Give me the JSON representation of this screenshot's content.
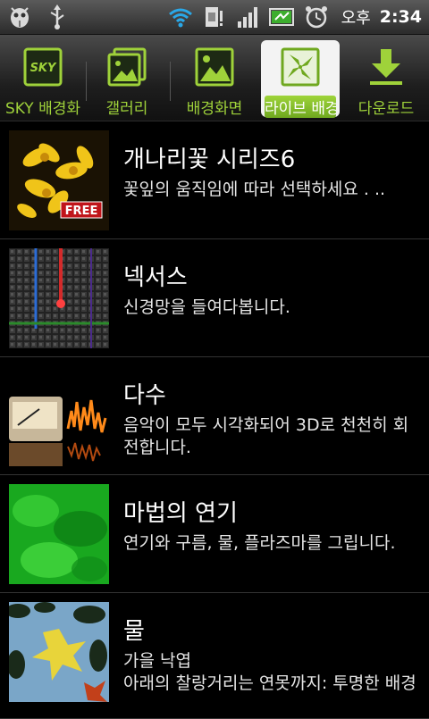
{
  "status": {
    "ampm": "오후",
    "time": "2:34"
  },
  "tabs": [
    {
      "label": "SKY 배경화",
      "icon": "sky-wallpaper-icon",
      "badge": "SKY"
    },
    {
      "label": "갤러리",
      "icon": "gallery-icon"
    },
    {
      "label": "배경화면",
      "icon": "wallpaper-icon"
    },
    {
      "label": "라이브 배경",
      "icon": "live-wallpaper-icon",
      "active": true
    },
    {
      "label": "다운로드",
      "icon": "download-icon"
    }
  ],
  "list": [
    {
      "title": "개나리꽃 시리즈6",
      "desc": "꽃잎의 움직임에 따라 선택하세요 . ..",
      "badge": "FREE"
    },
    {
      "title": "넥서스",
      "desc": "신경망을 들여다봅니다."
    },
    {
      "title": "다수",
      "desc": "음악이 모두 시각화되어 3D로 천천히 회전합니다."
    },
    {
      "title": "마법의 연기",
      "desc": "연기와 구름, 물, 플라즈마를 그립니다."
    },
    {
      "title": "물",
      "desc": "가을 낙엽\n아래의 찰랑거리는 연못까지: 투명한 배경"
    }
  ],
  "colors": {
    "accent": "#9fd23a",
    "background": "#000000"
  }
}
